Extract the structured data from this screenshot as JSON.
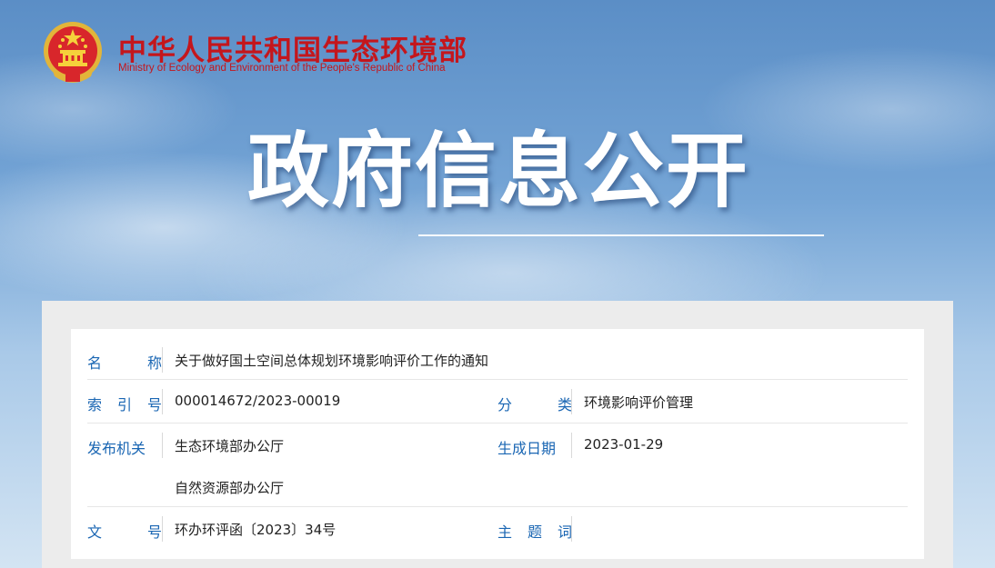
{
  "header": {
    "ministry_cn": "中华人民共和国生态环境部",
    "ministry_en": "Ministry of Ecology and Environment of the People's Republic of China"
  },
  "banner": {
    "title": "政府信息公开"
  },
  "info": {
    "name": {
      "label": [
        "名",
        "称"
      ],
      "value": "关于做好国土空间总体规划环境影响评价工作的通知"
    },
    "index": {
      "label": [
        "索",
        "引",
        "号"
      ],
      "value": "000014672/2023-00019"
    },
    "category": {
      "label": [
        "分",
        "类"
      ],
      "value": "环境影响评价管理"
    },
    "issuer": {
      "label": [
        "发布机关"
      ],
      "values": [
        "生态环境部办公厅",
        "自然资源部办公厅"
      ]
    },
    "date": {
      "label": [
        "生成日期"
      ],
      "value": "2023-01-29"
    },
    "doc_no": {
      "label": [
        "文",
        "号"
      ],
      "value": "环办环评函〔2023〕34号"
    },
    "subject": {
      "label": [
        "主",
        "题",
        "词"
      ],
      "value": ""
    }
  },
  "colors": {
    "brand_red": "#c4161c",
    "label_blue": "#1a66b3"
  }
}
